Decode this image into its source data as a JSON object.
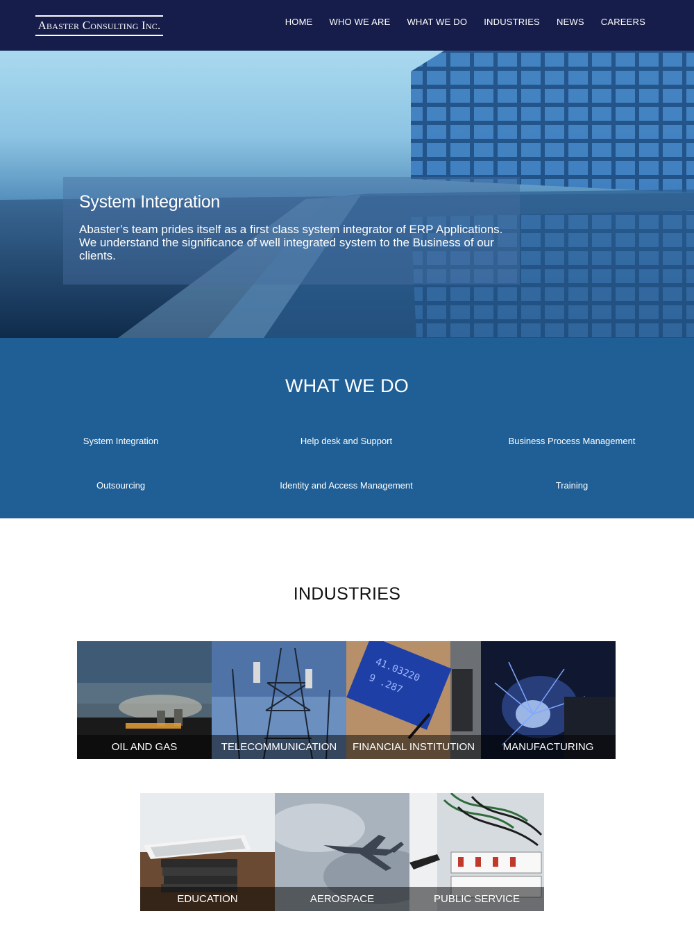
{
  "header": {
    "logo": "Abaster Consulting Inc.",
    "nav": [
      "HOME",
      "WHO WE ARE",
      "WHAT WE DO",
      "INDUSTRIES",
      "NEWS",
      "CAREERS"
    ]
  },
  "hero": {
    "title": "System Integration",
    "text": "Abaster’s team prides itself as a first class system integrator of ERP Applications. We understand the significance of well integrated system to the Business of our clients."
  },
  "what_we_do": {
    "title": "WHAT WE DO",
    "services": [
      "System Integration",
      "Help desk and Support",
      "Business Process Management",
      "Outsourcing",
      "Identity and Access Management",
      "Training"
    ]
  },
  "industries": {
    "title": "INDUSTRIES",
    "items": [
      "OIL AND GAS",
      "TELECOMMUNICATION",
      "FINANCIAL INSTITUTION",
      "MANUFACTURING",
      "EDUCATION",
      "AEROSPACE",
      "PUBLIC SERVICE"
    ]
  },
  "colors": {
    "header_bg": "#161d4a",
    "section_blue": "#1f5f95"
  }
}
